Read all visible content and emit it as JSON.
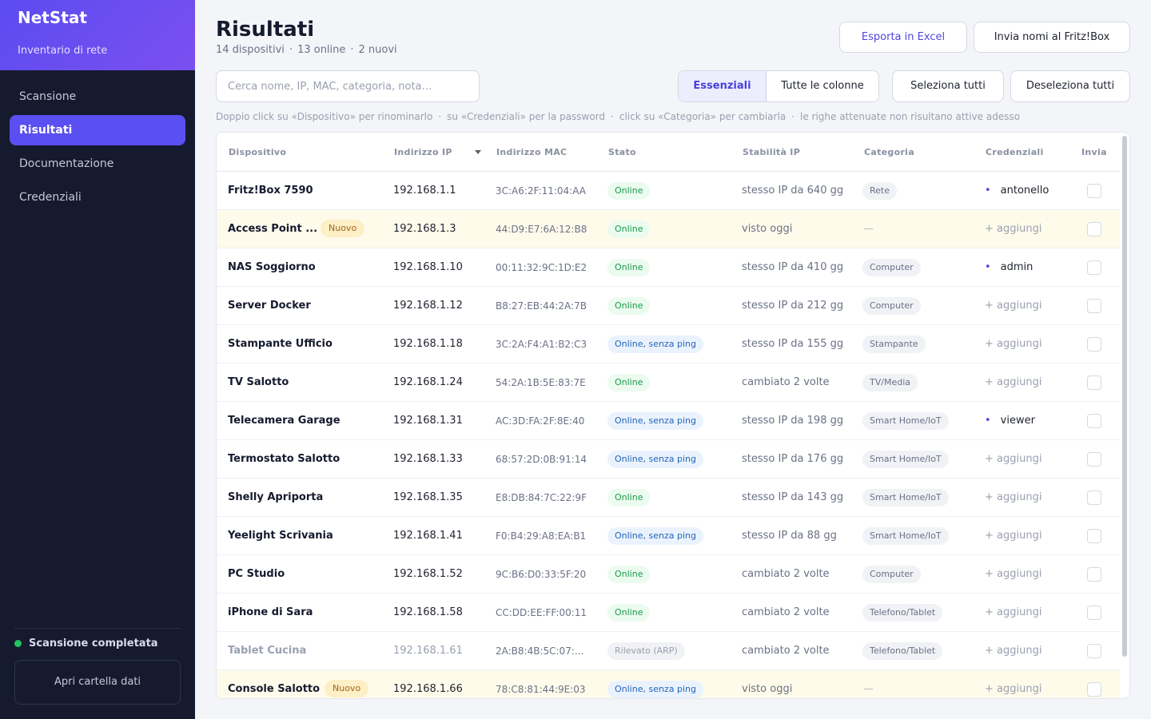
{
  "app": {
    "title": "NetStat",
    "subtitle": "Inventario di rete"
  },
  "nav": [
    {
      "label": "Scansione",
      "active": false
    },
    {
      "label": "Risultati",
      "active": true
    },
    {
      "label": "Documentazione",
      "active": false
    },
    {
      "label": "Credenziali",
      "active": false
    }
  ],
  "sidebar_footer": {
    "status": "Scansione completata",
    "status_color": "#22c55e",
    "open_folder": "Apri cartella dati"
  },
  "header": {
    "title": "Risultati",
    "devices": "14 dispositivi",
    "online": "13 online",
    "new": "2 nuovi",
    "export_button": "Esporta in Excel",
    "send_button": "Invia nomi al Fritz!Box"
  },
  "toolbar": {
    "search_placeholder": "Cerca nome, IP, MAC, categoria, nota…",
    "view_essential": "Essenziali",
    "view_all": "Tutte le colonne",
    "select_all": "Seleziona tutti",
    "deselect_all": "Deseleziona tutti"
  },
  "hints": [
    "Doppio click su «Dispositivo» per rinominarlo",
    "su «Credenziali» per la password",
    "click su «Categoria» per cambiarla",
    "le righe attenuate non risultano attive adesso"
  ],
  "table": {
    "columns": [
      "Dispositivo",
      "Indirizzo IP",
      "Indirizzo MAC",
      "Stato",
      "Stabilità IP",
      "Categoria",
      "Credenziali",
      "Invia"
    ],
    "add_label": "+ aggiungi",
    "new_badge": "Nuovo",
    "rows": [
      {
        "name": "Fritz!Box 7590",
        "ip": "192.168.1.1",
        "mac": "3C:A6:2F:11:04:AA",
        "status": "Online",
        "status_type": "online",
        "stability": "stesso IP da 640 gg",
        "category": "Rete",
        "credential": "antonello",
        "is_new": false,
        "dim": false
      },
      {
        "name": "Access Point ...",
        "ip": "192.168.1.3",
        "mac": "44:D9:E7:6A:12:B8",
        "status": "Online",
        "status_type": "online",
        "stability": "visto oggi",
        "category": "—",
        "credential": "",
        "is_new": true,
        "dim": false
      },
      {
        "name": "NAS Soggiorno",
        "ip": "192.168.1.10",
        "mac": "00:11:32:9C:1D:E2",
        "status": "Online",
        "status_type": "online",
        "stability": "stesso IP da 410 gg",
        "category": "Computer",
        "credential": "admin",
        "is_new": false,
        "dim": false
      },
      {
        "name": "Server Docker",
        "ip": "192.168.1.12",
        "mac": "B8:27:EB:44:2A:7B",
        "status": "Online",
        "status_type": "online",
        "stability": "stesso IP da 212 gg",
        "category": "Computer",
        "credential": "",
        "is_new": false,
        "dim": false
      },
      {
        "name": "Stampante Ufficio",
        "ip": "192.168.1.18",
        "mac": "3C:2A:F4:A1:B2:C3",
        "status": "Online, senza ping",
        "status_type": "noping",
        "stability": "stesso IP da 155 gg",
        "category": "Stampante",
        "credential": "",
        "is_new": false,
        "dim": false
      },
      {
        "name": "TV Salotto",
        "ip": "192.168.1.24",
        "mac": "54:2A:1B:5E:83:7E",
        "status": "Online",
        "status_type": "online",
        "stability": "cambiato 2 volte",
        "category": "TV/Media",
        "credential": "",
        "is_new": false,
        "dim": false
      },
      {
        "name": "Telecamera Garage",
        "ip": "192.168.1.31",
        "mac": "AC:3D:FA:2F:8E:40",
        "status": "Online, senza ping",
        "status_type": "noping",
        "stability": "stesso IP da 198 gg",
        "category": "Smart Home/IoT",
        "credential": "viewer",
        "is_new": false,
        "dim": false
      },
      {
        "name": "Termostato Salotto",
        "ip": "192.168.1.33",
        "mac": "68:57:2D:0B:91:14",
        "status": "Online, senza ping",
        "status_type": "noping",
        "stability": "stesso IP da 176 gg",
        "category": "Smart Home/IoT",
        "credential": "",
        "is_new": false,
        "dim": false
      },
      {
        "name": "Shelly Apriporta",
        "ip": "192.168.1.35",
        "mac": "E8:DB:84:7C:22:9F",
        "status": "Online",
        "status_type": "online",
        "stability": "stesso IP da 143 gg",
        "category": "Smart Home/IoT",
        "credential": "",
        "is_new": false,
        "dim": false
      },
      {
        "name": "Yeelight Scrivania",
        "ip": "192.168.1.41",
        "mac": "F0:B4:29:A8:EA:B1",
        "status": "Online, senza ping",
        "status_type": "noping",
        "stability": "stesso IP da 88 gg",
        "category": "Smart Home/IoT",
        "credential": "",
        "is_new": false,
        "dim": false
      },
      {
        "name": "PC Studio",
        "ip": "192.168.1.52",
        "mac": "9C:B6:D0:33:5F:20",
        "status": "Online",
        "status_type": "online",
        "stability": "cambiato 2 volte",
        "category": "Computer",
        "credential": "",
        "is_new": false,
        "dim": false
      },
      {
        "name": "iPhone di Sara",
        "ip": "192.168.1.58",
        "mac": "CC:DD:EE:FF:00:11",
        "status": "Online",
        "status_type": "online",
        "stability": "cambiato 2 volte",
        "category": "Telefono/Tablet",
        "credential": "",
        "is_new": false,
        "dim": false
      },
      {
        "name": "Tablet Cucina",
        "ip": "192.168.1.61",
        "mac": "2A:B8:4B:5C:07:...",
        "status": "Rilevato (ARP)",
        "status_type": "arp",
        "stability": "cambiato 2 volte",
        "category": "Telefono/Tablet",
        "credential": "",
        "is_new": false,
        "dim": true
      },
      {
        "name": "Console Salotto",
        "ip": "192.168.1.66",
        "mac": "78:C8:81:44:9E:03",
        "status": "Online, senza ping",
        "status_type": "noping",
        "stability": "visto oggi",
        "category": "—",
        "credential": "",
        "is_new": true,
        "dim": false
      }
    ]
  }
}
